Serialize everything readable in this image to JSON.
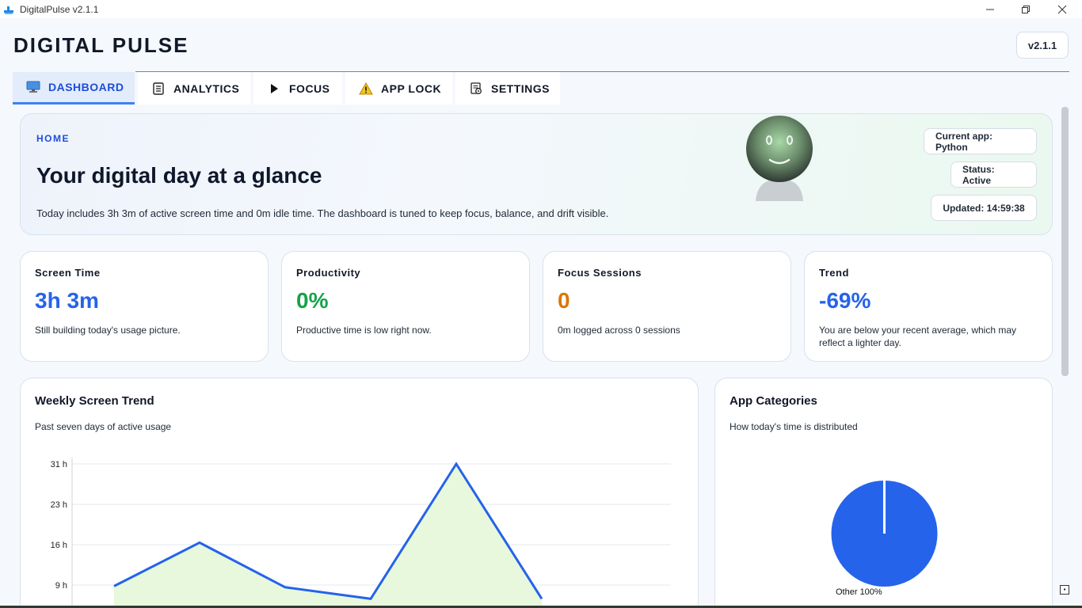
{
  "window": {
    "title": "DigitalPulse v2.1.1",
    "controls": [
      "minimize",
      "restore",
      "close"
    ]
  },
  "header": {
    "app_title": "DIGITAL PULSE",
    "version_label": "v2.1.1"
  },
  "tabs": [
    {
      "label": "DASHBOARD",
      "icon": "monitor-icon",
      "active": true
    },
    {
      "label": "ANALYTICS",
      "icon": "document-icon",
      "active": false
    },
    {
      "label": "FOCUS",
      "icon": "play-icon",
      "active": false
    },
    {
      "label": "APP LOCK",
      "icon": "warning-icon",
      "active": false
    },
    {
      "label": "SETTINGS",
      "icon": "settings-icon",
      "active": false
    }
  ],
  "hero": {
    "kicker": "HOME",
    "headline": "Your digital day at a glance",
    "description": "Today includes 3h 3m of active screen time and 0m idle time. The dashboard is tuned to keep focus, balance, and drift visible.",
    "current_app": "Current app: Python",
    "status": "Status: Active",
    "updated": "Updated: 14:59:38"
  },
  "stats": [
    {
      "label": "Screen Time",
      "value": "3h 3m",
      "note": "Still building today's usage picture.",
      "color": "#2563eb"
    },
    {
      "label": "Productivity",
      "value": "0%",
      "note": "Productive time is low right now.",
      "color": "#16a34a"
    },
    {
      "label": "Focus Sessions",
      "value": "0",
      "note": "0m logged across 0 sessions",
      "color": "#d97706"
    },
    {
      "label": "Trend",
      "value": "-69%",
      "note": "You are below your recent average, which may reflect a lighter day.",
      "color": "#2563eb"
    }
  ],
  "weekly": {
    "title": "Weekly Screen Trend",
    "subtitle": "Past seven days of active usage"
  },
  "categories": {
    "title": "App Categories",
    "subtitle": "How today's time is distributed",
    "slice_label": "Other 100%"
  },
  "chart_data": [
    {
      "type": "area",
      "title": "Weekly Screen Trend",
      "y_ticks": [
        "9 h",
        "16 h",
        "23 h",
        "31 h"
      ],
      "y_unit": "h",
      "visible_points": [
        {
          "index": 0,
          "y": 8.8
        },
        {
          "index": 1,
          "y": 16.7
        },
        {
          "index": 2,
          "y": 8.6
        },
        {
          "index": 3,
          "y": 6.5
        },
        {
          "index": 4,
          "y": 31
        },
        {
          "index": 5,
          "y": 6.5
        }
      ],
      "colors": {
        "line": "#2563eb",
        "fill": "#e7f8dc"
      }
    },
    {
      "type": "pie",
      "title": "App Categories",
      "slices": [
        {
          "name": "Other",
          "value": 100
        }
      ],
      "colors": {
        "slice": "#2563eb"
      }
    }
  ]
}
